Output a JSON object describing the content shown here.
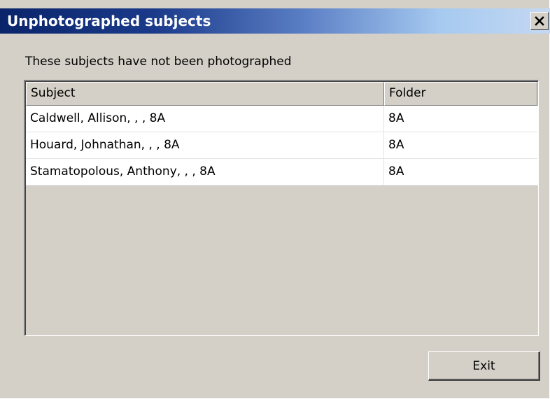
{
  "window": {
    "title": "Unphotographed subjects",
    "close_icon": "close-icon"
  },
  "prompt": "These subjects have not been photographed",
  "table": {
    "columns": [
      "Subject",
      "Folder"
    ],
    "rows": [
      [
        "Caldwell, Allison, , , 8A",
        "8A"
      ],
      [
        "Houard, Johnathan, , , 8A",
        "8A"
      ],
      [
        "Stamatopolous, Anthony, , , 8A",
        "8A"
      ]
    ]
  },
  "buttons": {
    "exit_label": "Exit"
  },
  "colors": {
    "titlebar_start": "#0a246a",
    "titlebar_end": "#c4d8f2",
    "window_background": "#d4d0c8",
    "row_background": "#ffffff"
  }
}
